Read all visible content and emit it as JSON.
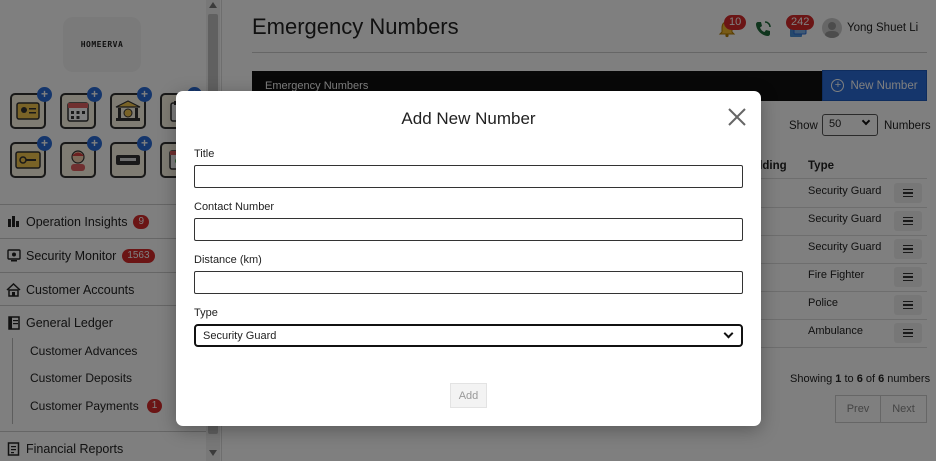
{
  "sidebar": {
    "logo_text": "HOMEERVA",
    "nav": [
      {
        "label": "Operation Insights",
        "badge": "9"
      },
      {
        "label": "Security Monitor",
        "badge": "1563"
      },
      {
        "label": "Customer Accounts"
      },
      {
        "label": "General Ledger"
      }
    ],
    "sub_items": [
      {
        "label": "Customer Advances"
      },
      {
        "label": "Customer Deposits"
      },
      {
        "label": "Customer Payments",
        "badge": "1"
      }
    ],
    "bottom_item": {
      "label": "Financial Reports"
    }
  },
  "header": {
    "title": "Emergency Numbers",
    "notifications_badge": "10",
    "tasks_badge": "242",
    "user_name": "Yong Shuet Li"
  },
  "main": {
    "table_title": "Emergency Numbers",
    "new_button_label": "New Number",
    "show_label": "Show",
    "show_value": "50",
    "numbers_label": "Numbers",
    "columns": {
      "building": "ilding",
      "type": "Type"
    },
    "rows": [
      {
        "type": "Security Guard"
      },
      {
        "type": "Security Guard"
      },
      {
        "type": "Security Guard"
      },
      {
        "type": "Fire Fighter"
      },
      {
        "type": "Police"
      },
      {
        "type": "Ambulance"
      }
    ],
    "showing_prefix": "Showing ",
    "showing_from": "1",
    "showing_mid1": " to ",
    "showing_to": "6",
    "showing_mid2": " of ",
    "showing_total": "6",
    "showing_suffix": " numbers",
    "prev_label": "Prev",
    "next_label": "Next"
  },
  "modal": {
    "title": "Add New Number",
    "fields": {
      "title_label": "Title",
      "title_value": "",
      "contact_label": "Contact Number",
      "contact_value": "",
      "distance_label": "Distance (km)",
      "distance_value": "",
      "type_label": "Type",
      "type_value": "Security Guard"
    },
    "add_label": "Add"
  },
  "colors": {
    "accent": "#2a6dd9",
    "badge": "#d62b2b",
    "header_bar": "#111111"
  }
}
